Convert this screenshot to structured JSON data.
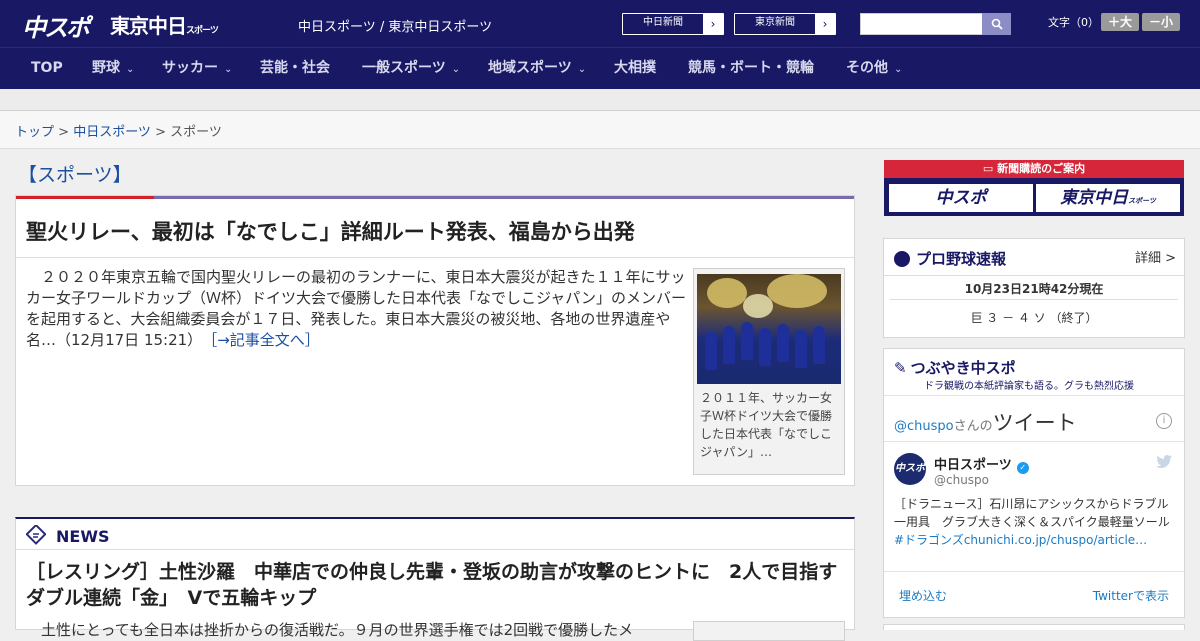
{
  "header": {
    "logo_chuspo": "中スポ",
    "logo_tokyo": "東京中日",
    "logo_tokyo_small": "スポーツ",
    "site_title": "中日スポーツ / 東京中日スポーツ",
    "pill1": "中日新聞",
    "pill2": "東京新聞",
    "arrow": "›",
    "search_icon": "search-icon",
    "fontsize_label": "文字（0）",
    "font_plus": "＋大",
    "font_minus": "－小"
  },
  "nav": {
    "items": [
      "TOP",
      "野球",
      "サッカー",
      "芸能・社会",
      "一般スポーツ",
      "地域スポーツ",
      "大相撲",
      "競馬・ボート・競輪",
      "その他"
    ],
    "chevron": "⌄"
  },
  "breadcrumb": {
    "top": "トップ",
    "sep": " > ",
    "chunichi": "中日スポーツ",
    "current": "スポーツ"
  },
  "section": {
    "heading": "【スポーツ】"
  },
  "article": {
    "title": "聖火リレー、最初は「なでしこ」詳細ルート発表、福島から出発",
    "body": "　２０２０年東京五輪で国内聖火リレーの最初のランナーに、東日本大震災が起きた１１年にサッカー女子ワールドカップ（Ｗ杯）ドイツ大会で優勝した日本代表「なでしこジャパン」のメンバーを起用すると、大会組織委員会が１７日、発表した。東日本大震災の被災地、各地の世界遺産や名…（12月17日 15:21）",
    "more": "［→記事全文へ］",
    "photo_caption": "２０１１年、サッカー女子Ｗ杯ドイツ大会で優勝した日本代表「なでしこジャパン」…"
  },
  "news": {
    "label": "NEWS",
    "icon": "news-icon",
    "title": "［レスリング］土性沙羅　中華店での仲良し先輩・登坂の助言が攻撃のヒントに　2人で目指すダブル連続「金」　Vで五輪キップ",
    "excerpt": "　土性にとっても全日本は挫折からの復活戦だ。９月の世界選手権では2回戦で優勝したメ"
  },
  "subscribe": {
    "head": "新聞購読のご案内",
    "chuspo": "中スポ",
    "tokyo": "東京中日",
    "tokyo_small": "スポーツ"
  },
  "baseball": {
    "title": "プロ野球速報",
    "detail": "詳細 >",
    "time": "10月23日21時42分現在",
    "score": "巨 ３ － ４ ソ （終了）"
  },
  "tweets": {
    "title": "つぶやき中スポ",
    "subtitle": "ドラ観戦の本紙評論家も語る。グラも熱烈応援",
    "hdr_at": "@chuspo",
    "hdr_san": "さんの",
    "hdr_big": "ツイート",
    "info": "i",
    "avatar": "中スポ",
    "user_name": "中日スポーツ",
    "verified": "✓",
    "handle": "@chuspo",
    "bird": "🐦",
    "text": "［ドラニュース］石川昂にアシックスからドラブル一用具　グラブ大きく深く＆スパイク最軽量ソール",
    "text_link": "#ドラゴンズchunichi.co.jp/chuspo/article…",
    "embed": "埋め込む",
    "view": "Twitterで表示"
  }
}
